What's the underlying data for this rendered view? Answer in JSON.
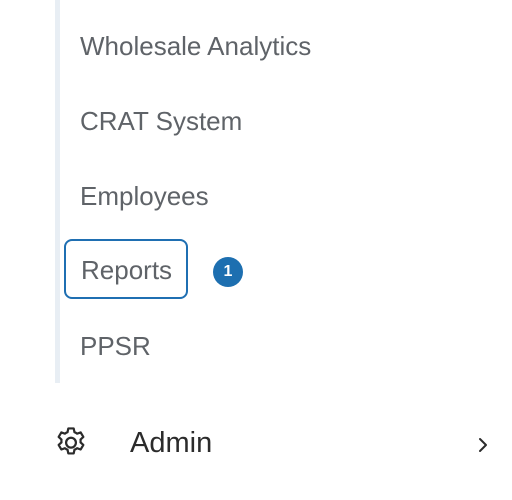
{
  "submenu": {
    "items": [
      {
        "label": "Wholesale Analytics"
      },
      {
        "label": "CRAT System"
      },
      {
        "label": "Employees"
      },
      {
        "label": "Reports",
        "badge": "1"
      },
      {
        "label": "PPSR"
      }
    ]
  },
  "admin": {
    "label": "Admin",
    "icon": "gear-icon",
    "expand_icon": "chevron-right-icon"
  },
  "colors": {
    "accent": "#1f6fb2",
    "text": "#5f6368",
    "rail": "#e8eef4"
  }
}
